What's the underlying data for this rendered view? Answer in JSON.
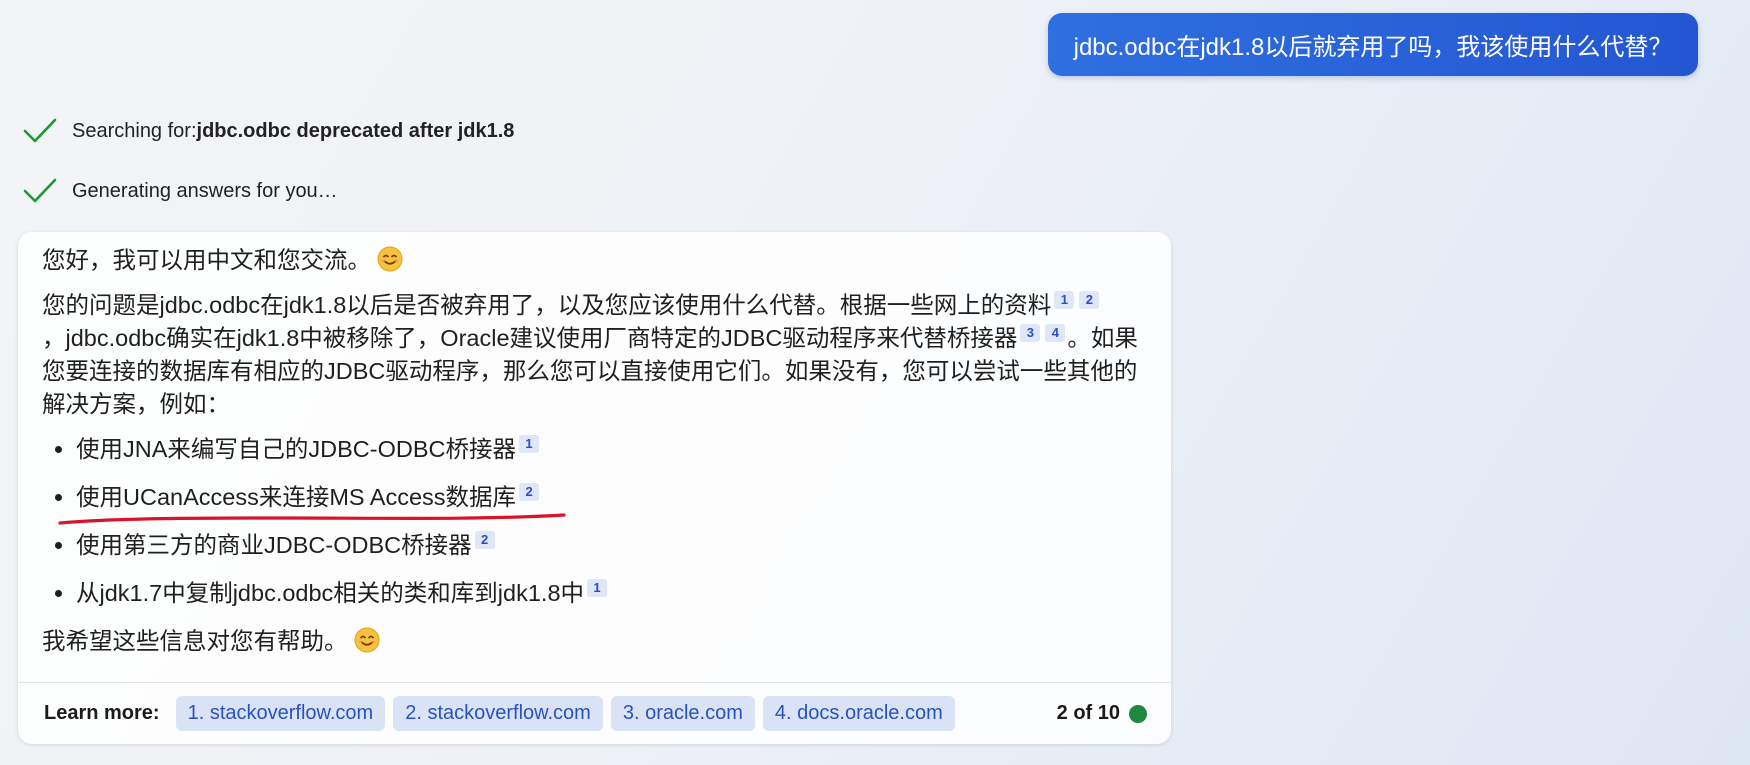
{
  "user_message": "jdbc.odbc在jdk1.8以后就弃用了吗，我该使用什么代替？",
  "status": {
    "searching_prefix": "Searching for: ",
    "searching_query": "jdbc.odbc deprecated after jdk1.8",
    "generating": "Generating answers for you…"
  },
  "answer": {
    "greeting": "您好，我可以用中文和您交流。",
    "p1_a": "您的问题是jdbc.odbc在jdk1.8以后是否被弃用了，以及您应该使用什么代替。根据一些网上的资料",
    "p1_b": "，jdbc.odbc确实在jdk1.8中被移除了，Oracle建议使用厂商特定的JDBC驱动程序来代替桥接器",
    "p1_c": "。如果您要连接的数据库有相应的JDBC驱动程序，那么您可以直接使用它们。如果没有，您可以尝试一些其他的解决方案，例如：",
    "items": [
      {
        "text": "使用JNA来编写自己的JDBC-ODBC桥接器",
        "cite": "1"
      },
      {
        "text": "使用UCanAccess来连接MS Access数据库",
        "cite": "2"
      },
      {
        "text": "使用第三方的商业JDBC-ODBC桥接器",
        "cite": "2"
      },
      {
        "text": "从jdk1.7中复制jdbc.odbc相关的类和库到jdk1.8中",
        "cite": "1"
      }
    ],
    "closing": "我希望这些信息对您有帮助。"
  },
  "cites": {
    "c1": "1",
    "c2": "2",
    "c3": "3",
    "c4": "4"
  },
  "learn_more": {
    "label": "Learn more:",
    "sources": [
      "1. stackoverflow.com",
      "2. stackoverflow.com",
      "3. oracle.com",
      "4. docs.oracle.com"
    ],
    "count": "2 of 10"
  },
  "colors": {
    "accent": "#2456d2",
    "check": "#1a9a2e",
    "underline": "#d9142a",
    "status_dot": "#1e8a3e"
  },
  "icons": [
    "check-icon",
    "smile-emoji-icon",
    "status-dot-icon"
  ]
}
